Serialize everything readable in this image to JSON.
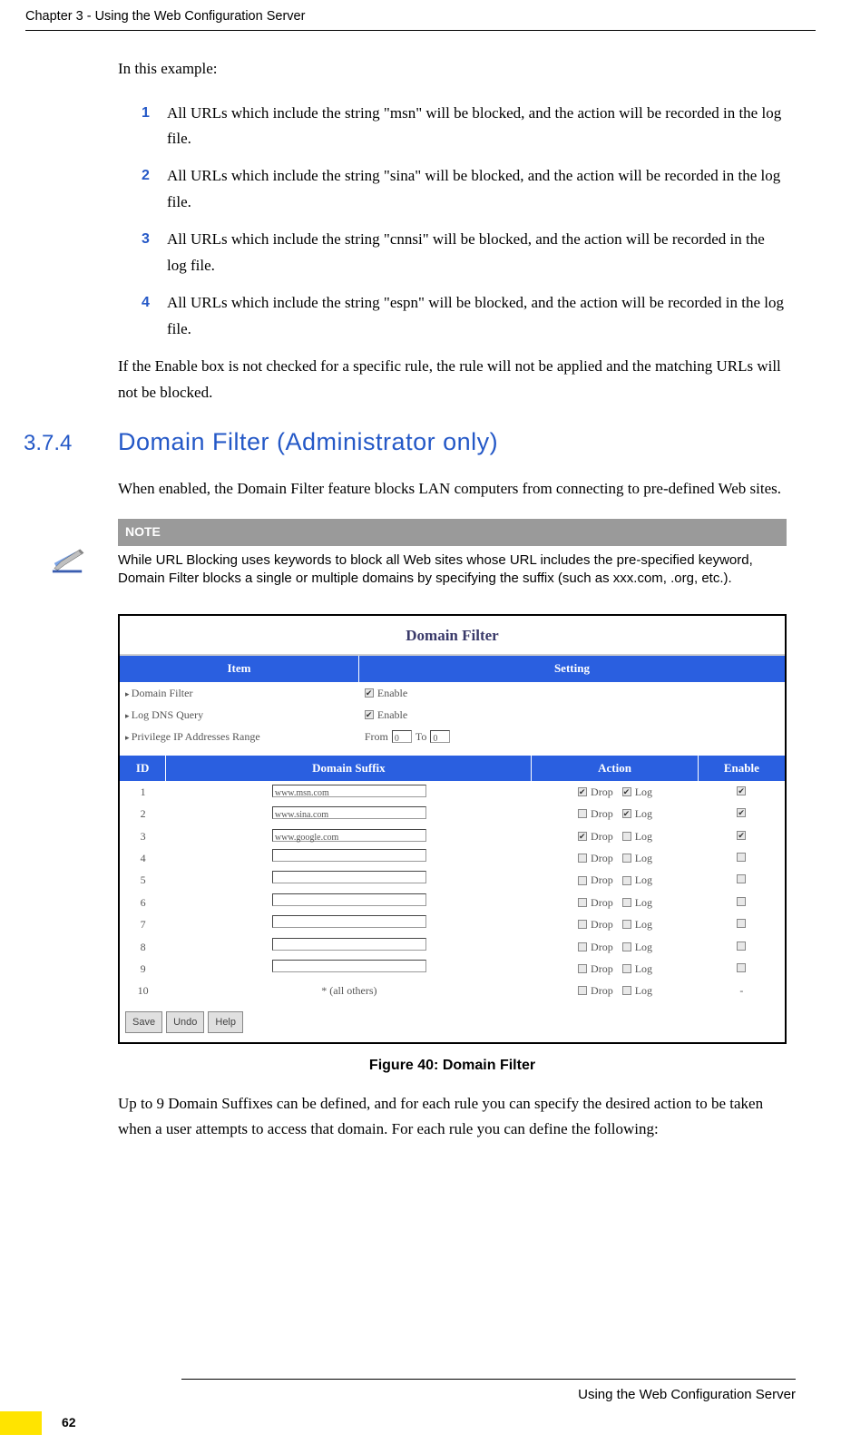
{
  "header": {
    "chapter_line": "Chapter 3 - Using the Web Configuration Server"
  },
  "body": {
    "intro": "In this example:",
    "list": [
      {
        "num": "1",
        "text": "All URLs which include the string \"msn\" will be blocked, and the action will be recorded in the log file."
      },
      {
        "num": "2",
        "text": "All URLs which include the string \"sina\" will be blocked, and the action will be recorded in the log file."
      },
      {
        "num": "3",
        "text": "All URLs which include the string \"cnnsi\" will be blocked, and the action will be recorded in the log file."
      },
      {
        "num": "4",
        "text": "All URLs which include the string \"espn\" will be blocked, and the action will be recorded in the log file."
      }
    ],
    "after_list": "If the Enable box is not checked for a specific rule, the rule will not be applied and the matching URLs will not be blocked.",
    "section_num": "3.7.4",
    "section_title": "Domain Filter (Administrator only)",
    "section_text": "When enabled, the Domain Filter feature blocks LAN computers from connecting to pre-defined Web sites.",
    "note_label": "NOTE",
    "note_text": "While URL Blocking uses keywords to block all Web sites whose URL includes the pre-specified keyword, Domain Filter blocks a single or multiple domains by specifying the suffix (such as xxx.com, .org, etc.).",
    "after_figure": "Up to 9 Domain Suffixes can be defined, and for each rule you can specify the desired action to be taken when a user attempts to access that domain. For each rule you can define the following:"
  },
  "figure": {
    "title_bar": "Domain Filter",
    "head1": {
      "item": "Item",
      "setting": "Setting"
    },
    "settings_rows": [
      {
        "label": "Domain Filter",
        "control": "checkbox",
        "checked": true,
        "text": "Enable"
      },
      {
        "label": "Log DNS Query",
        "control": "checkbox",
        "checked": true,
        "text": "Enable"
      },
      {
        "label": "Privilege IP Addresses Range",
        "control": "range",
        "from_label": "From",
        "from_val": "0",
        "to_label": "To",
        "to_val": "0"
      }
    ],
    "head2": {
      "id": "ID",
      "suffix": "Domain Suffix",
      "action": "Action",
      "enable": "Enable"
    },
    "rows": [
      {
        "id": "1",
        "suffix": "www.msn.com",
        "drop": true,
        "log": true,
        "enable": true,
        "enable_shown": true
      },
      {
        "id": "2",
        "suffix": "www.sina.com",
        "drop": false,
        "log": true,
        "enable": true,
        "enable_shown": true
      },
      {
        "id": "3",
        "suffix": "www.google.com",
        "drop": true,
        "log": false,
        "enable": true,
        "enable_shown": true
      },
      {
        "id": "4",
        "suffix": "",
        "drop": false,
        "log": false,
        "enable": false,
        "enable_shown": true
      },
      {
        "id": "5",
        "suffix": "",
        "drop": false,
        "log": false,
        "enable": false,
        "enable_shown": true
      },
      {
        "id": "6",
        "suffix": "",
        "drop": false,
        "log": false,
        "enable": false,
        "enable_shown": true
      },
      {
        "id": "7",
        "suffix": "",
        "drop": false,
        "log": false,
        "enable": false,
        "enable_shown": true
      },
      {
        "id": "8",
        "suffix": "",
        "drop": false,
        "log": false,
        "enable": false,
        "enable_shown": true
      },
      {
        "id": "9",
        "suffix": "",
        "drop": false,
        "log": false,
        "enable": false,
        "enable_shown": true
      },
      {
        "id": "10",
        "suffix": "* (all others)",
        "drop": false,
        "log": false,
        "enable": false,
        "enable_shown": false,
        "is_all": true
      }
    ],
    "drop_label": "Drop",
    "log_label": "Log",
    "buttons": {
      "save": "Save",
      "undo": "Undo",
      "help": "Help"
    },
    "caption": "Figure 40: Domain Filter"
  },
  "footer": {
    "line": "Using the Web Configuration Server",
    "page": "62"
  }
}
